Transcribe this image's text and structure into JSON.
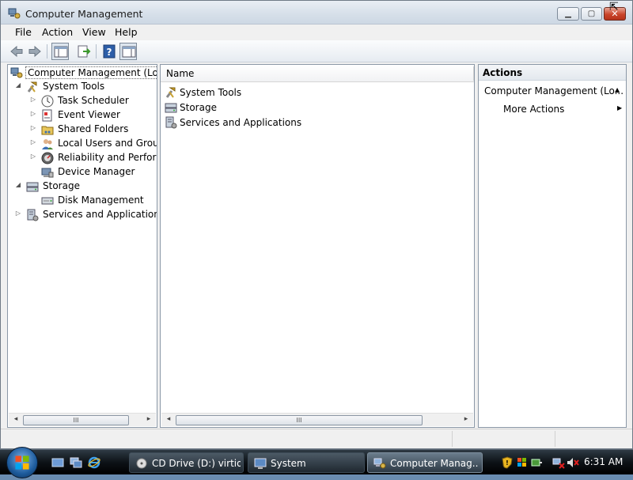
{
  "window": {
    "title": "Computer Management",
    "controls": {
      "minimize": "▁",
      "maximize": "▢",
      "close": "✕"
    }
  },
  "menu": [
    "File",
    "Action",
    "View",
    "Help"
  ],
  "toolbar": {
    "buttons": [
      "back-arrow-icon",
      "forward-arrow-icon",
      "show-hide-tree-icon",
      "export-list-icon",
      "help-icon",
      "action-pane-icon"
    ]
  },
  "tree": [
    {
      "label": "Computer Management (Local",
      "icon": "computer-management-icon",
      "expander": "",
      "selected": true
    },
    {
      "label": "System Tools",
      "icon": "system-tools-icon",
      "expander": "◢"
    },
    {
      "label": "Task Scheduler",
      "icon": "task-scheduler-icon",
      "expander": "▷"
    },
    {
      "label": "Event Viewer",
      "icon": "event-viewer-icon",
      "expander": "▷"
    },
    {
      "label": "Shared Folders",
      "icon": "shared-folders-icon",
      "expander": "▷"
    },
    {
      "label": "Local Users and Groups",
      "icon": "local-users-icon",
      "expander": "▷"
    },
    {
      "label": "Reliability and Performa",
      "icon": "reliability-icon",
      "expander": "▷"
    },
    {
      "label": "Device Manager",
      "icon": "device-manager-icon",
      "expander": ""
    },
    {
      "label": "Storage",
      "icon": "storage-icon",
      "expander": "◢"
    },
    {
      "label": "Disk Management",
      "icon": "disk-management-icon",
      "expander": ""
    },
    {
      "label": "Services and Applications",
      "icon": "services-icon",
      "expander": "▷"
    }
  ],
  "list": {
    "column": "Name",
    "items": [
      {
        "label": "System Tools",
        "icon": "system-tools-icon"
      },
      {
        "label": "Storage",
        "icon": "storage-icon"
      },
      {
        "label": "Services and Applications",
        "icon": "services-icon"
      }
    ]
  },
  "scroll": {
    "left_arrow": "◂",
    "right_arrow": "▸",
    "grip": "III"
  },
  "actions": {
    "title": "Actions",
    "section": "Computer Management (Lo...",
    "section_caret": "▲",
    "item": "More Actions",
    "item_caret": "▶"
  },
  "taskbar": {
    "tasks": [
      {
        "label": "CD Drive (D:) virtio...",
        "icon": "cd-drive-icon",
        "active": false
      },
      {
        "label": "System",
        "icon": "system-icon",
        "active": false
      },
      {
        "label": "Computer Manag...",
        "icon": "computer-management-icon",
        "active": true
      }
    ],
    "clock": "6:31 AM"
  }
}
